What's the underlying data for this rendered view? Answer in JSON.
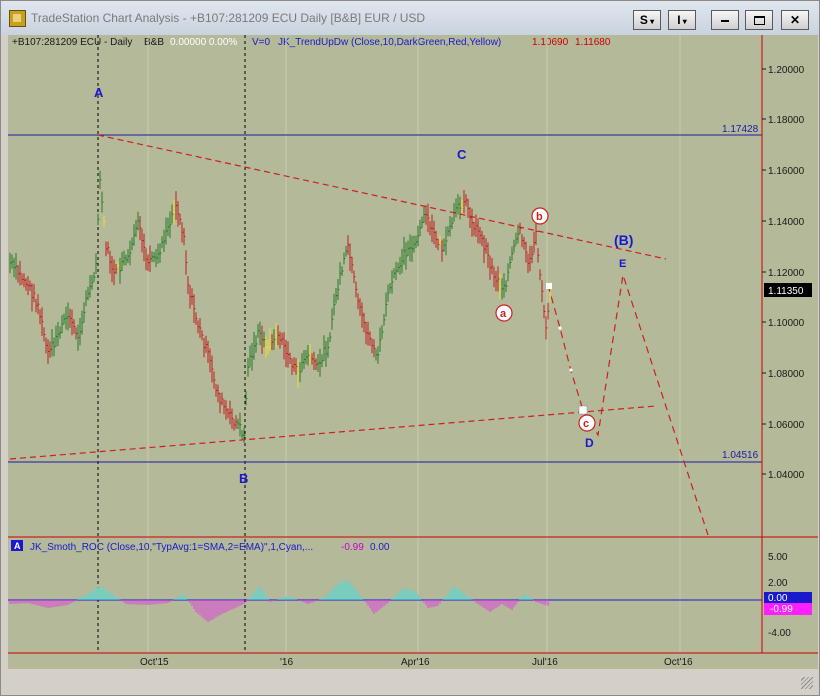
{
  "window": {
    "title": "TradeStation Chart Analysis - +B107:281209 ECU Daily [B&B] EUR / USD",
    "s_menu_label": "S",
    "i_menu_label": "I",
    "minimize_icon": "minimize-icon",
    "restore_icon": "restore-icon",
    "close_icon": "close-icon"
  },
  "colors": {
    "chart_bg": "#b3b999",
    "price_axis_line": "#cc0000",
    "horizontal_lines": "#1a1aa8",
    "trendlines": "#cc2020",
    "bar_green": "#2a7a2a",
    "bar_red": "#c02020",
    "bar_yellow": "#e8e030",
    "roc_cyan": "#40e0e0",
    "roc_magenta": "#e040e0",
    "wave_labels": "#1a1acc"
  },
  "price_pane": {
    "header_symbol": "+B107:281209 ECU - Daily",
    "header_bb": "B&B",
    "header_values": "0.00000  0.00%",
    "header_v0": "V=0",
    "header_indicator": "JK_TrendUpDw (Close,10,DarkGreen,Red,Yellow)",
    "header_val1": "1.10690",
    "header_val2": "1.11680",
    "y_axis_ticks": [
      "1.20000",
      "1.18000",
      "1.16000",
      "1.14000",
      "1.12000",
      "1.10000",
      "1.08000",
      "1.06000",
      "1.04000"
    ],
    "hline_upper_label": "1.17428",
    "hline_lower_label": "1.04516",
    "last_price_label": "1.11350",
    "wave_labels": {
      "A": "A",
      "B": "B",
      "C": "C",
      "D": "D",
      "E": "E",
      "big_B": "(B)",
      "a": "a",
      "b": "b",
      "c": "c"
    }
  },
  "roc_pane": {
    "badge": "A",
    "header_indicator": "JK_Smoth_ROC (Close,10,\"TypAvg:1=SMA,2=EMA)\",1,Cyan,...",
    "header_val1": "-0.99",
    "header_val2": "0.00",
    "y_axis_ticks": [
      "5.00",
      "2.00",
      "0.00",
      "-2.00",
      "-4.00"
    ],
    "zero_label": "0.00",
    "current_label": "-0.99"
  },
  "x_axis": {
    "labels": [
      "Oct'15",
      "'16",
      "Apr'16",
      "Jul'16",
      "Oct'16"
    ]
  }
}
